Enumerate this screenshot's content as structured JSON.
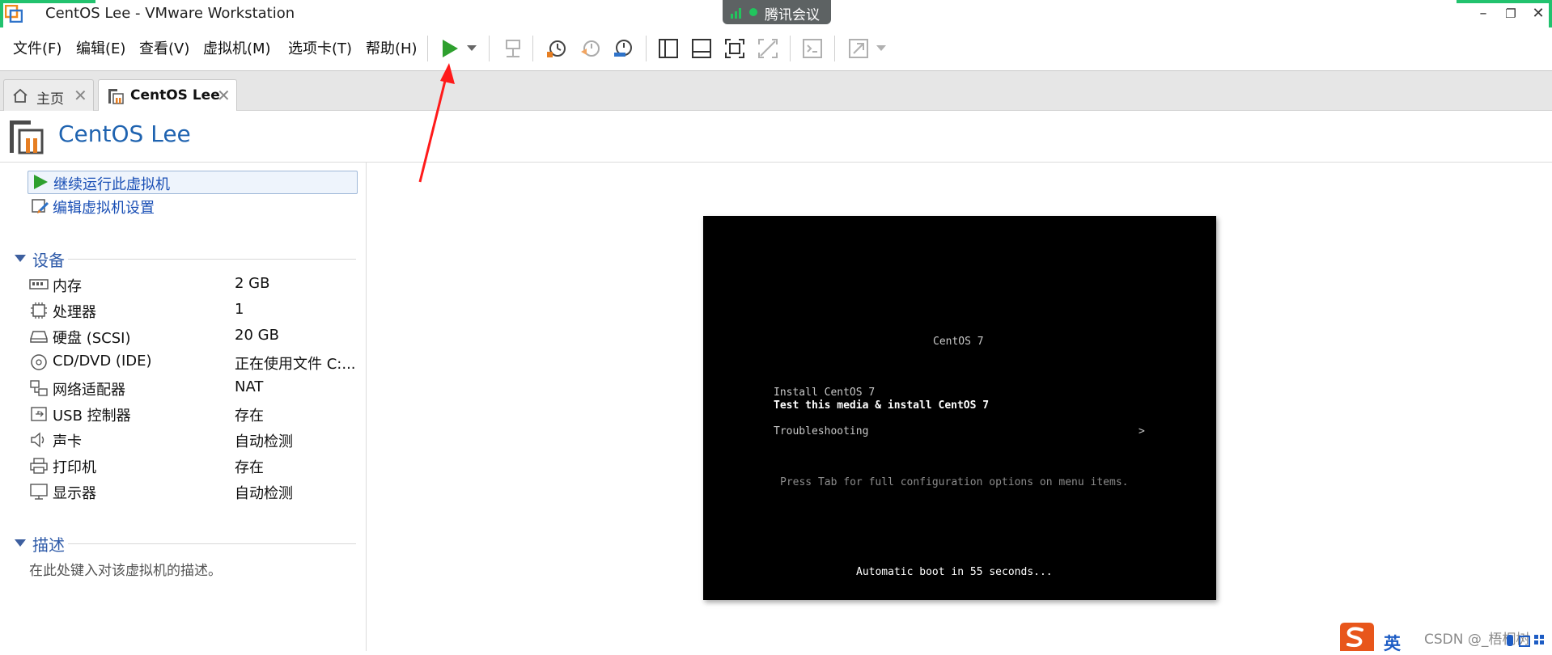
{
  "window": {
    "title": "CentOS Lee - VMware Workstation",
    "controls": [
      "–",
      "❐",
      "✕"
    ]
  },
  "meeting": {
    "label": "腾讯会议"
  },
  "menu": {
    "items": [
      "文件(F)",
      "编辑(E)",
      "查看(V)",
      "虚拟机(M)",
      "选项卡(T)",
      "帮助(H)"
    ]
  },
  "tabs": [
    {
      "label": "主页",
      "active": false
    },
    {
      "label": "CentOS Lee",
      "active": true
    }
  ],
  "vm": {
    "name": "CentOS Lee"
  },
  "actions": {
    "run": "继续运行此虚拟机",
    "edit": "编辑虚拟机设置"
  },
  "devices": {
    "heading": "设备",
    "rows": [
      {
        "name": "内存",
        "value": "2 GB",
        "icon": "memory-icon"
      },
      {
        "name": "处理器",
        "value": "1",
        "icon": "cpu-icon"
      },
      {
        "name": "硬盘 (SCSI)",
        "value": "20 GB",
        "icon": "harddisk-icon"
      },
      {
        "name": "CD/DVD (IDE)",
        "value": "正在使用文件 C:...",
        "icon": "cd-dvd-icon"
      },
      {
        "name": "网络适配器",
        "value": "NAT",
        "icon": "network-icon"
      },
      {
        "name": "USB 控制器",
        "value": "存在",
        "icon": "usb-icon"
      },
      {
        "name": "声卡",
        "value": "自动检测",
        "icon": "speaker-icon"
      },
      {
        "name": "打印机",
        "value": "存在",
        "icon": "printer-icon"
      },
      {
        "name": "显示器",
        "value": "自动检测",
        "icon": "monitor-icon"
      }
    ]
  },
  "description": {
    "heading": "描述",
    "placeholder": "在此处键入对该虚拟机的描述。"
  },
  "console": {
    "title": "CentOS 7",
    "menu_items": [
      "Install CentOS 7",
      "Test this media & install CentOS 7"
    ],
    "troubleshooting": "Troubleshooting",
    "chevron": ">",
    "hint": "Press Tab for full configuration options on menu items.",
    "countdown": "Automatic boot in 55 seconds..."
  },
  "ime": {
    "label": "英"
  },
  "watermark": "CSDN @_梧桐树",
  "colors": {
    "accent": "#1f63b0",
    "play": "#2ea02e",
    "annotation_arrow": "#ff1a1a",
    "highlight_border": "#22c26e"
  }
}
